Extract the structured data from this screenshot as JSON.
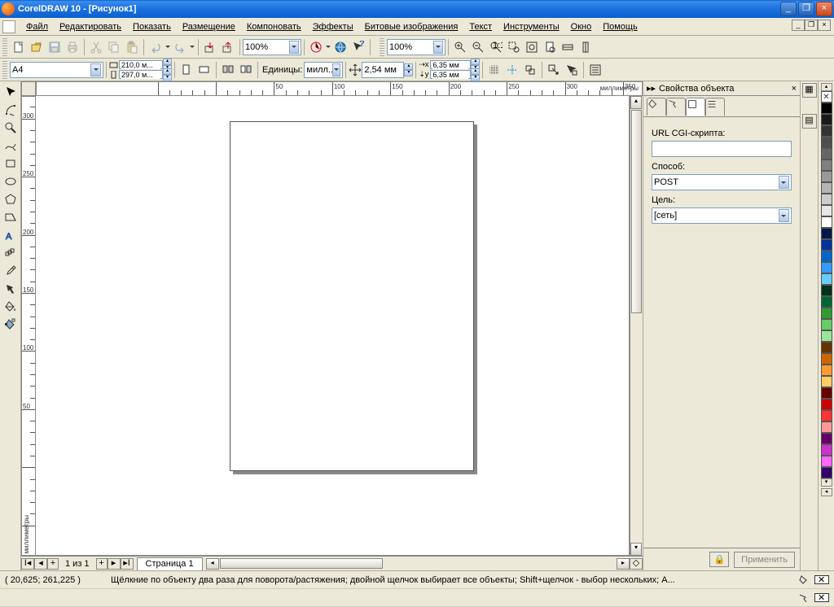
{
  "title": "CorelDRAW 10 - [Рисунок1]",
  "menu": [
    "Файл",
    "Редактировать",
    "Показать",
    "Размещение",
    "Компоновать",
    "Эффекты",
    "Битовые изображения",
    "Текст",
    "Инструменты",
    "Окно",
    "Помощь"
  ],
  "toolbar1": {
    "zoom": "100%"
  },
  "toolbar_view": {
    "zoom": "100%"
  },
  "propbar": {
    "paper": "A4",
    "width": "210,0 м...",
    "height": "297,0 м...",
    "units_label": "Единицы:",
    "units_value": "милл...",
    "nudge": "2,54 мм",
    "dup_x": "6,35 мм",
    "dup_y": "6,35 мм"
  },
  "ruler": {
    "h_labels": [
      "50",
      "100",
      "150",
      "200",
      "250",
      "300"
    ],
    "h_unit": "миллиметры",
    "v_labels": [
      "50",
      "100",
      "150",
      "200",
      "250",
      "300"
    ],
    "v_unit": "миллиметры"
  },
  "docker": {
    "title": "Свойства объекта",
    "url_label": "URL CGI-скрипта:",
    "url_value": "",
    "method_label": "Способ:",
    "method_value": "POST",
    "target_label": "Цель:",
    "target_value": "[сеть]",
    "apply": "Применить"
  },
  "pagebar": {
    "counter": "1 из 1",
    "tab": "Страница 1"
  },
  "status": {
    "coords": "( 20,625; 261,225 )",
    "hint": "Щёлкние по объекту два раза для поворота/растяжения; двойной щелчок выбирает все объекты; Shift+щелчок - выбор нескольких; A..."
  },
  "palette": [
    "#000000",
    "#1a1a1a",
    "#333333",
    "#4d4d4d",
    "#666666",
    "#808080",
    "#999999",
    "#b3b3b3",
    "#cccccc",
    "#e6e6e6",
    "#ffffff",
    "#00194c",
    "#003399",
    "#0066cc",
    "#3399ff",
    "#66ccff",
    "#003319",
    "#006633",
    "#339933",
    "#66cc66",
    "#99e699",
    "#663300",
    "#cc6600",
    "#ff9933",
    "#ffcc66",
    "#660000",
    "#cc0000",
    "#ff3333",
    "#ff9999",
    "#660066",
    "#cc33cc",
    "#ff66ff",
    "#330066"
  ]
}
